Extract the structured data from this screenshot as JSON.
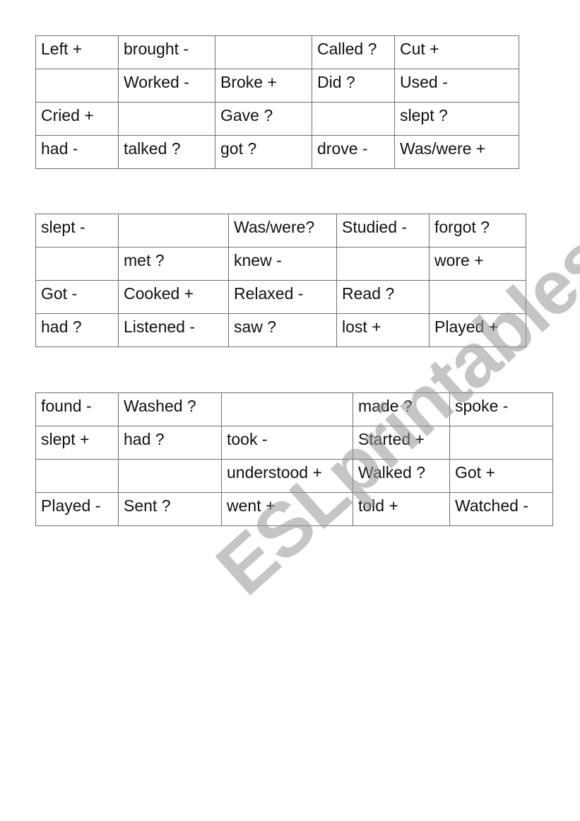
{
  "watermark": "ESLprintables.com",
  "tables": [
    {
      "rows": [
        [
          "Left +",
          "brought -",
          "",
          "Called ?",
          "Cut +"
        ],
        [
          "",
          "Worked -",
          "Broke +",
          "Did ?",
          "Used -"
        ],
        [
          "Cried +",
          "",
          "Gave ?",
          "",
          "slept ?"
        ],
        [
          "had -",
          "talked ?",
          "got ?",
          "drove -",
          "Was/were +"
        ]
      ]
    },
    {
      "rows": [
        [
          "slept -",
          "",
          "Was/were?",
          "Studied -",
          "forgot ?"
        ],
        [
          "",
          "met ?",
          "knew -",
          "",
          "wore +"
        ],
        [
          "Got -",
          "Cooked +",
          "Relaxed -",
          "Read ?",
          ""
        ],
        [
          "had ?",
          "Listened -",
          "saw ?",
          "lost +",
          "Played +"
        ]
      ]
    },
    {
      "rows": [
        [
          "found -",
          "Washed ?",
          "",
          "made ?",
          "spoke -"
        ],
        [
          "slept +",
          "had ?",
          "took -",
          "Started +",
          ""
        ],
        [
          "",
          "",
          "understood +",
          "Walked ?",
          "Got +"
        ],
        [
          "Played -",
          "Sent ?",
          "went +",
          "told +",
          "Watched -"
        ]
      ]
    }
  ]
}
